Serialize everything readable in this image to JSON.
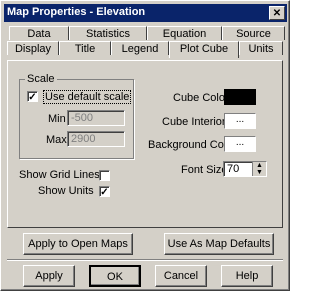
{
  "window": {
    "title": "Map Properties - Elevation",
    "close_glyph": "✕"
  },
  "tabs_row1": [
    "Data",
    "Statistics",
    "Equation",
    "Source"
  ],
  "tabs_row2": [
    "Display",
    "Title",
    "Legend",
    "Plot Cube",
    "Units"
  ],
  "active_tab": "Plot Cube",
  "scale": {
    "label": "Scale",
    "use_default_label": "Use default scale",
    "use_default_checked": true,
    "min_label": "Min",
    "min_value": "-500",
    "max_label": "Max",
    "max_value": "2900"
  },
  "options": {
    "show_grid_lines_label": "Show Grid Lines",
    "show_grid_lines_checked": false,
    "show_units_label": "Show Units",
    "show_units_checked": true
  },
  "colors": {
    "cube_color_label": "Cube Color",
    "cube_color": "#000000",
    "cube_interior_label": "Cube Interior",
    "cube_interior_btn": "...",
    "background_color_label": "Background Color",
    "background_color_btn": "..."
  },
  "font": {
    "label": "Font Size",
    "value": "70"
  },
  "buttons": {
    "apply_open": "Apply to Open Maps",
    "defaults": "Use As Map Defaults",
    "apply": "Apply",
    "ok": "OK",
    "cancel": "Cancel",
    "help": "Help"
  }
}
